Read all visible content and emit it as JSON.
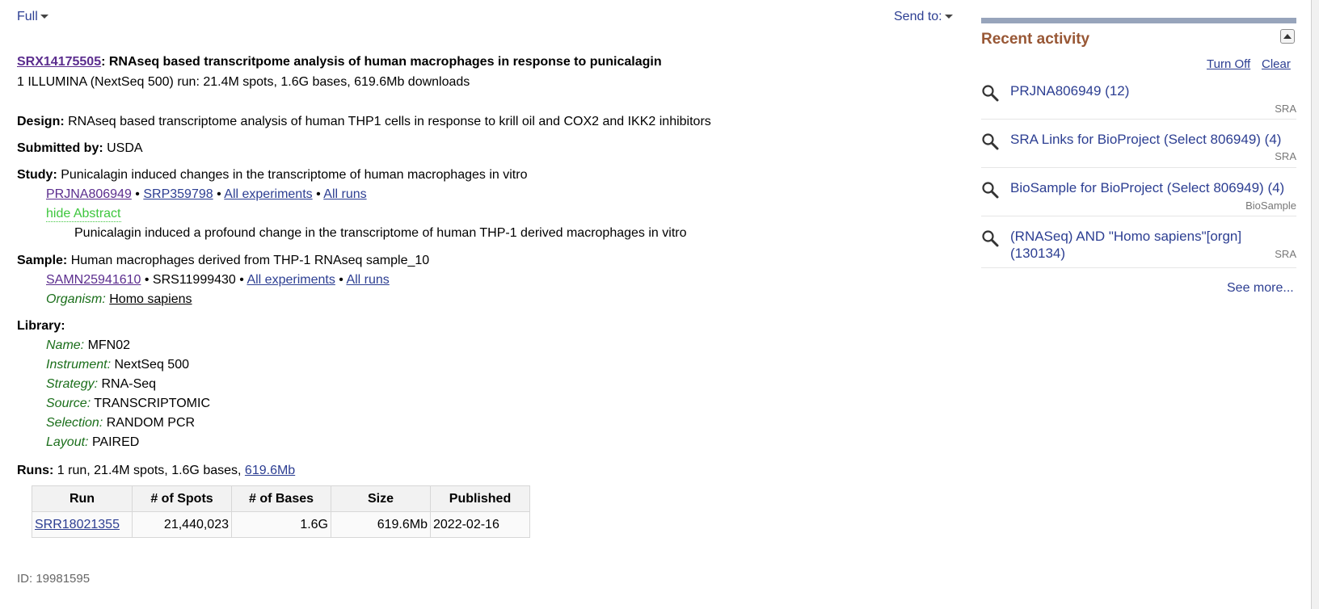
{
  "toolbar": {
    "format": "Full",
    "send_to": "Send to:"
  },
  "record": {
    "accession": "SRX14175505",
    "title": "RNAseq based transcritpome analysis of human macrophages in response to punicalagin",
    "summary": "1 ILLUMINA (NextSeq 500) run: 21.4M spots, 1.6G bases, 619.6Mb downloads"
  },
  "design": {
    "label": "Design:",
    "text": "RNAseq based transcriptome analysis of human THP1 cells in response to krill oil and COX2 and IKK2 inhibitors"
  },
  "submitted": {
    "label": "Submitted by:",
    "text": "USDA"
  },
  "study": {
    "label": "Study:",
    "text": "Punicalagin induced changes in the transcriptome of human macrophages in vitro",
    "bioproject": "PRJNA806949",
    "srp": "SRP359798",
    "all_experiments": "All experiments",
    "all_runs": "All runs",
    "hide_abstract": "hide Abstract",
    "abstract": "Punicalagin induced a profound change in the transcriptome of human THP-1 derived macrophages in vitro"
  },
  "sample": {
    "label": "Sample:",
    "text": "Human macrophages derived from THP-1 RNAseq sample_10",
    "biosample": "SAMN25941610",
    "srs": "SRS11999430",
    "all_experiments": "All experiments",
    "all_runs": "All runs",
    "organism_label": "Organism:",
    "organism": "Homo sapiens"
  },
  "library": {
    "label": "Library:",
    "fields": [
      {
        "name": "Name:",
        "value": "MFN02"
      },
      {
        "name": "Instrument:",
        "value": "NextSeq 500"
      },
      {
        "name": "Strategy:",
        "value": "RNA-Seq"
      },
      {
        "name": "Source:",
        "value": "TRANSCRIPTOMIC"
      },
      {
        "name": "Selection:",
        "value": "RANDOM PCR"
      },
      {
        "name": "Layout:",
        "value": "PAIRED"
      }
    ]
  },
  "runs": {
    "label": "Runs:",
    "summary": "1 run, 21.4M spots, 1.6G bases,",
    "size_link": "619.6Mb",
    "headers": [
      "Run",
      "# of Spots",
      "# of Bases",
      "Size",
      "Published"
    ],
    "rows": [
      {
        "run": "SRR18021355",
        "spots": "21,440,023",
        "bases": "1.6G",
        "size": "619.6Mb",
        "published": "2022-02-16"
      }
    ]
  },
  "footer": {
    "id": "ID: 19981595"
  },
  "recent_activity": {
    "title": "Recent activity",
    "turn_off": "Turn Off",
    "clear": "Clear",
    "items": [
      {
        "text": "PRJNA806949 (12)",
        "db": "SRA",
        "icon": "search-icon"
      },
      {
        "text": "SRA Links for BioProject (Select 806949) (4)",
        "db": "SRA",
        "icon": "search-icon"
      },
      {
        "text": "BioSample for BioProject (Select 806949) (4)",
        "db": "BioSample",
        "icon": "search-icon"
      },
      {
        "text": "(RNASeq) AND \"Homo sapiens\"[orgn] (130134)",
        "db": "SRA",
        "icon": "search-icon"
      }
    ],
    "see_more": "See more..."
  },
  "colors": {
    "link": "#2c3e92",
    "visited": "#5b2d8e",
    "field": "#1a6e1a",
    "abstract_toggle": "#3ec63e",
    "recent_title": "#985735"
  }
}
